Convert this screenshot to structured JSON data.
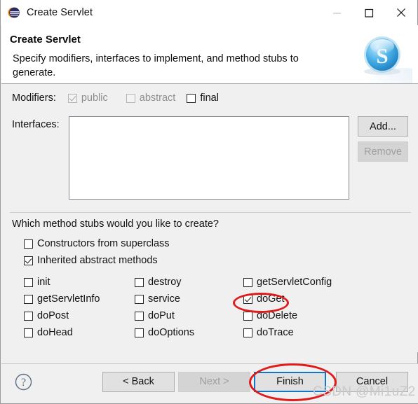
{
  "window": {
    "title": "Create Servlet",
    "icon": "eclipse-icon",
    "controls": {
      "minimize": "minimize-icon",
      "maximize": "maximize-icon",
      "close": "close-icon"
    }
  },
  "header": {
    "title": "Create Servlet",
    "description": "Specify modifiers, interfaces to implement, and method stubs to generate.",
    "logo": "servlet-s-icon"
  },
  "modifiers": {
    "label": "Modifiers:",
    "items": [
      {
        "label": "public",
        "checked": true,
        "enabled": false
      },
      {
        "label": "abstract",
        "checked": false,
        "enabled": false
      },
      {
        "label": "final",
        "checked": false,
        "enabled": true
      }
    ]
  },
  "interfaces": {
    "label": "Interfaces:",
    "value": "",
    "add_label": "Add...",
    "remove_label": "Remove",
    "remove_enabled": false
  },
  "stubs": {
    "question": "Which method stubs would you like to create?",
    "constructors": {
      "label": "Constructors from superclass",
      "checked": false
    },
    "inherited": {
      "label": "Inherited abstract methods",
      "checked": true
    },
    "methods": [
      {
        "label": "init",
        "checked": false
      },
      {
        "label": "destroy",
        "checked": false
      },
      {
        "label": "getServletConfig",
        "checked": false
      },
      {
        "label": "getServletInfo",
        "checked": false
      },
      {
        "label": "service",
        "checked": false
      },
      {
        "label": "doGet",
        "checked": true
      },
      {
        "label": "doPost",
        "checked": false
      },
      {
        "label": "doPut",
        "checked": false
      },
      {
        "label": "doDelete",
        "checked": false
      },
      {
        "label": "doHead",
        "checked": false
      },
      {
        "label": "doOptions",
        "checked": false
      },
      {
        "label": "doTrace",
        "checked": false
      }
    ]
  },
  "footer": {
    "help": "help-icon",
    "back_label": "< Back",
    "next_label": "Next >",
    "next_enabled": false,
    "finish_label": "Finish",
    "cancel_label": "Cancel",
    "default_button": "Finish"
  },
  "annotations": {
    "color": "#e01b1b",
    "ellipses": [
      "doGet",
      "Finish"
    ],
    "watermark": "CSDN @Mi1uZ2"
  }
}
